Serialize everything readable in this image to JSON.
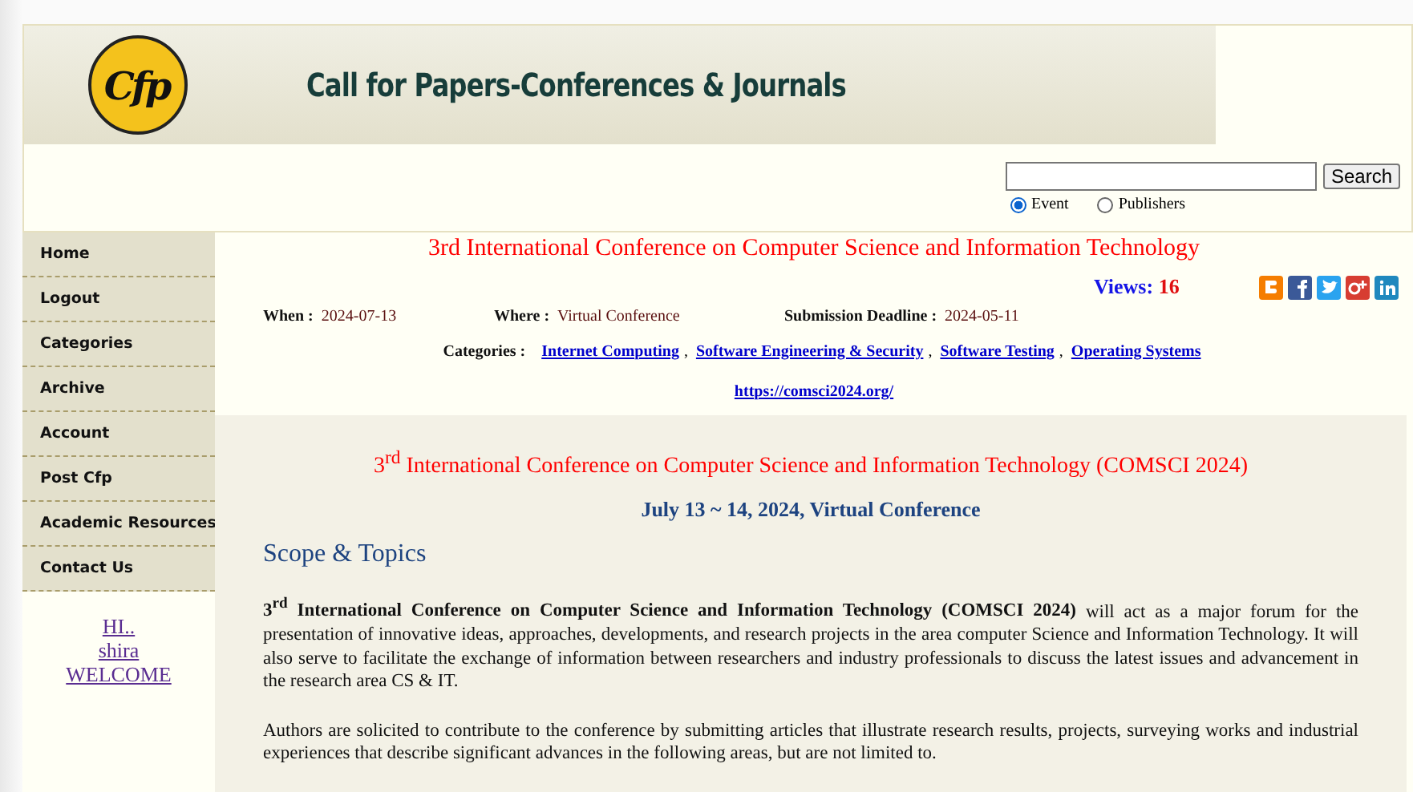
{
  "header": {
    "logo_text": "Cfp",
    "title": "Call for Papers-Conferences & Journals"
  },
  "search": {
    "button": "Search",
    "options": [
      {
        "label": "Event",
        "selected": true
      },
      {
        "label": "Publishers",
        "selected": false
      }
    ]
  },
  "sidebar": {
    "items": [
      {
        "label": "Home"
      },
      {
        "label": "Logout"
      },
      {
        "label": "Categories"
      },
      {
        "label": "Archive"
      },
      {
        "label": "Account"
      },
      {
        "label": "Post Cfp"
      },
      {
        "label": "Academic Resources"
      },
      {
        "label": "Contact Us"
      }
    ],
    "greeting": [
      "HI..",
      "shira",
      "WELCOME"
    ]
  },
  "event": {
    "title": "3rd International Conference on Computer Science and Information Technology",
    "views_label": "Views:",
    "views": "16",
    "share": [
      {
        "kind": "blogger",
        "color": "#f57d00"
      },
      {
        "kind": "facebook",
        "color": "#3b5998"
      },
      {
        "kind": "twitter",
        "color": "#2aa3ef"
      },
      {
        "kind": "googleplus",
        "color": "#d73d32"
      },
      {
        "kind": "linkedin",
        "color": "#1f88be"
      }
    ],
    "facts": [
      {
        "label": "When :",
        "value": "2024-07-13"
      },
      {
        "label": "Where :",
        "value": "Virtual Conference"
      },
      {
        "label": "Submission Deadline :",
        "value": "2024-05-11"
      }
    ],
    "categories_label": "Categories :",
    "separator": ",",
    "categories": [
      "Internet Computing",
      "Software Engineering & Security",
      "Software Testing",
      "Operating Systems"
    ],
    "url": "https://comsci2024.org/"
  },
  "details": {
    "heading": "3$^{rd}$ International Conference on Computer Science and Information Technology (COMSCI 2024)",
    "dates": "July 13 ~ 14, 2024, Virtual Conference",
    "section": "Scope & Topics",
    "paragraphs": [
      "**3$^{rd}$ International Conference on Computer Science and Information Technology (COMSCI 2024)** will act as a major forum for the presentation of innovative ideas, approaches, developments, and research projects in the area computer Science and Information Technology. It will also serve to facilitate the exchange of information between researchers and industry professionals to discuss the latest issues and advancement in the research area CS & IT.",
      "Authors are solicited to contribute to the conference by submitting articles that illustrate research results, projects, surveying works and industrial experiences that describe significant advances in the following areas, but are not limited to."
    ]
  }
}
